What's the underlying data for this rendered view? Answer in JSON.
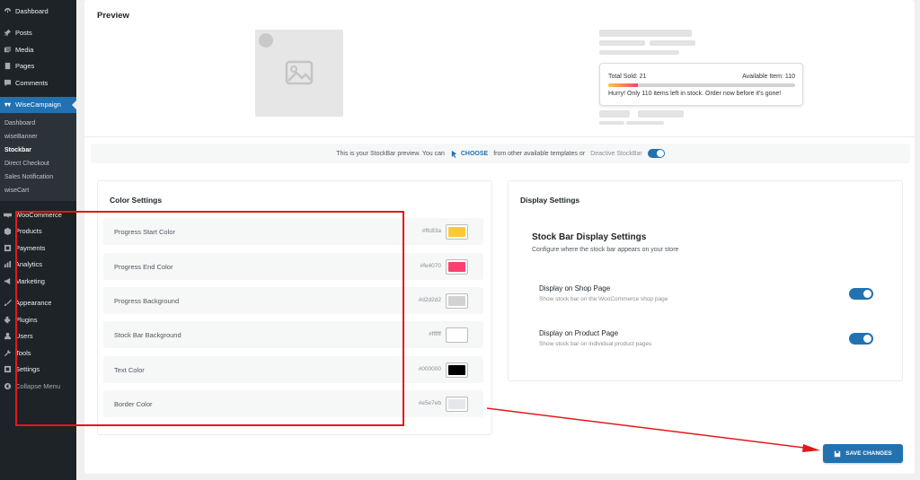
{
  "sidebar": {
    "items_top": [
      {
        "label": "Dashboard",
        "icon": "dashboard-icon"
      },
      {
        "label": "Posts",
        "icon": "pin-icon"
      },
      {
        "label": "Media",
        "icon": "media-icon"
      },
      {
        "label": "Pages",
        "icon": "page-icon"
      },
      {
        "label": "Comments",
        "icon": "comment-icon"
      }
    ],
    "active": {
      "label": "WiseCampaign",
      "icon": "wisecampaign-icon"
    },
    "submenu": [
      "Dashboard",
      "wiseBanner",
      "Stockbar",
      "Direct Checkout",
      "Sales Notification",
      "wiseCart"
    ],
    "items_bottom": [
      {
        "label": "WooCommerce",
        "icon": "woo-icon"
      },
      {
        "label": "Products",
        "icon": "box-icon"
      },
      {
        "label": "Payments",
        "icon": "payment-icon"
      },
      {
        "label": "Analytics",
        "icon": "chart-icon"
      },
      {
        "label": "Marketing",
        "icon": "megaphone-icon"
      },
      {
        "label": "Appearance",
        "icon": "brush-icon"
      },
      {
        "label": "Plugins",
        "icon": "plugin-icon"
      },
      {
        "label": "Users",
        "icon": "user-icon"
      },
      {
        "label": "Tools",
        "icon": "wrench-icon"
      },
      {
        "label": "Settings",
        "icon": "settings-icon"
      },
      {
        "label": "Collapse Menu",
        "icon": "collapse-icon"
      }
    ]
  },
  "preview": {
    "title": "Preview",
    "stock": {
      "sold": "Total Sold: 21",
      "available": "Available Item: 110",
      "progress": 0.16,
      "message": "Hurry! Only 110 items left in stock. Order now before it's gone!"
    }
  },
  "notice": {
    "text": "This is your StockBar preview. You can",
    "choose": "CHOOSE",
    "suffix": "from other available templates or",
    "deactivate": "Deactive StockBar"
  },
  "color_settings": {
    "title": "Color Settings",
    "rows": [
      {
        "label": "Progress Start Color",
        "hex": "#ffc83a",
        "color": "#ffc83a"
      },
      {
        "label": "Progress End Color",
        "hex": "#fe4070",
        "color": "#fe4070"
      },
      {
        "label": "Progress Background",
        "hex": "#d2d2d2",
        "color": "#d2d2d2"
      },
      {
        "label": "Stock Bar Background",
        "hex": "#ffffff",
        "color": "#ffffff"
      },
      {
        "label": "Text Color",
        "hex": "#000000",
        "color": "#000000"
      },
      {
        "label": "Border Color",
        "hex": "#e5e7eb",
        "color": "#e5e7eb"
      }
    ]
  },
  "display_settings": {
    "title": "Display Settings",
    "heading": "Stock Bar Display Settings",
    "subtitle": "Configure where the stock bar appears on your store",
    "options": [
      {
        "title": "Display on Shop Page",
        "desc": "Show stock bar on the WooCommerce shop page",
        "enabled": true
      },
      {
        "title": "Display on Product Page",
        "desc": "Show stock bar on individual product pages",
        "enabled": true
      }
    ]
  },
  "save_label": "SAVE CHANGES",
  "colors": {
    "accent": "#2271b1",
    "highlight": "#e5171b",
    "sidebar": "#1d2327"
  }
}
